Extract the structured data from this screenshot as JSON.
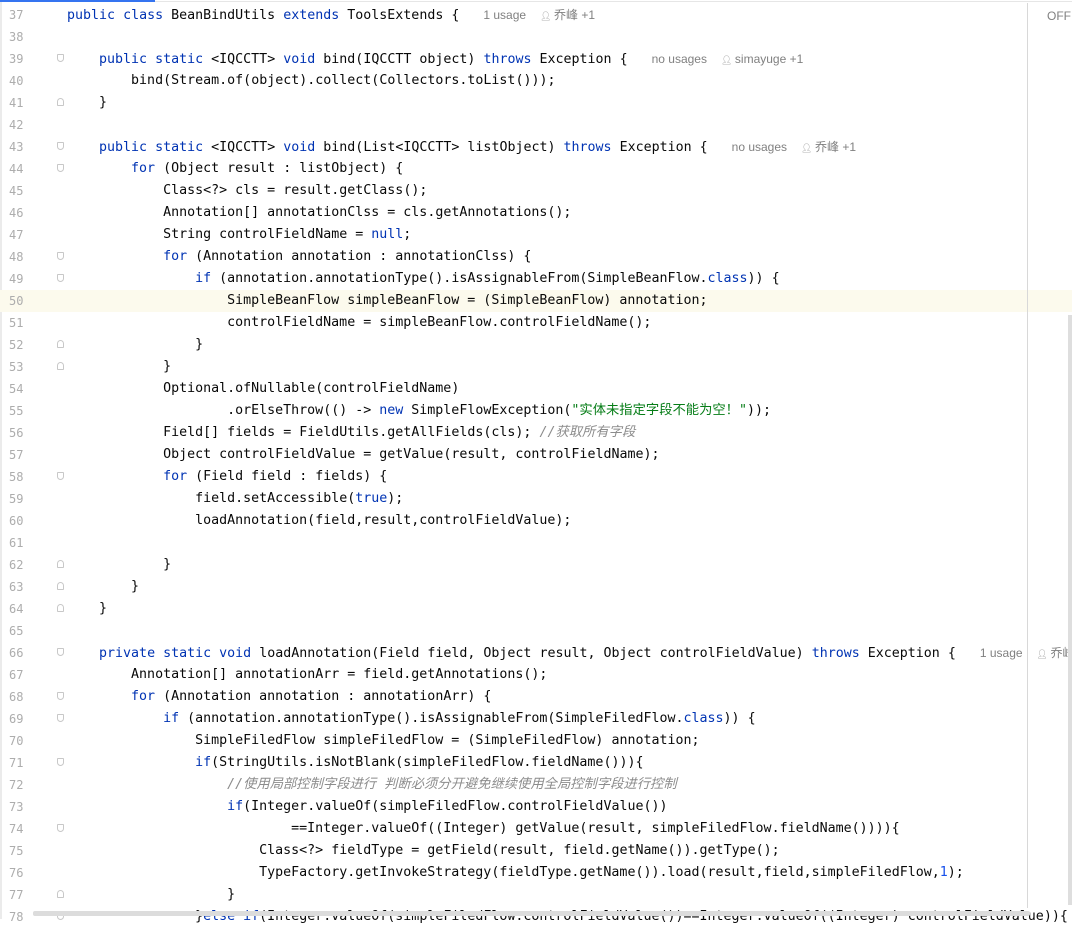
{
  "editor": {
    "inspection_toggle": "OFF",
    "current_line": 50,
    "colors": {
      "keyword": "#0033b3",
      "string": "#067d17",
      "comment": "#8c8c8c",
      "number": "#1750eb",
      "current_line_bg": "#fcfaed",
      "line_number": "#adadad"
    },
    "keywords": [
      "public",
      "class",
      "extends",
      "static",
      "void",
      "throws",
      "for",
      "if",
      "else",
      "new",
      "null",
      "true",
      "private"
    ],
    "lines": [
      {
        "n": "37",
        "code": "public class BeanBindUtils extends ToolsExtends { ",
        "usages": "1 usage",
        "author": "乔峰 +1"
      },
      {
        "n": "38",
        "code": ""
      },
      {
        "n": "39",
        "code": "    public static <IQCCTT> void bind(IQCCTT object) throws Exception { ",
        "usages": "no usages",
        "author": "simayuge +1",
        "fold": "open"
      },
      {
        "n": "40",
        "code": "        bind(Stream.of(object).collect(Collectors.toList()));"
      },
      {
        "n": "41",
        "code": "    }",
        "fold": "close"
      },
      {
        "n": "42",
        "code": ""
      },
      {
        "n": "43",
        "code": "    public static <IQCCTT> void bind(List<IQCCTT> listObject) throws Exception { ",
        "usages": "no usages",
        "author": "乔峰 +1",
        "fold": "open"
      },
      {
        "n": "44",
        "code": "        for (Object result : listObject) {",
        "fold": "open"
      },
      {
        "n": "45",
        "code": "            Class<?> cls = result.getClass();"
      },
      {
        "n": "46",
        "code": "            Annotation[] annotationClss = cls.getAnnotations();"
      },
      {
        "n": "47",
        "code": "            String controlFieldName = null;"
      },
      {
        "n": "48",
        "code": "            for (Annotation annotation : annotationClss) {",
        "fold": "open"
      },
      {
        "n": "49",
        "code": "                if (annotation.annotationType().isAssignableFrom(SimpleBeanFlow.class)) {",
        "fold": "open"
      },
      {
        "n": "50",
        "code": "                    SimpleBeanFlow simpleBeanFlow = (SimpleBeanFlow) annotation;"
      },
      {
        "n": "51",
        "code": "                    controlFieldName = simpleBeanFlow.controlFieldName();"
      },
      {
        "n": "52",
        "code": "                }",
        "fold": "close"
      },
      {
        "n": "53",
        "code": "            }",
        "fold": "close"
      },
      {
        "n": "54",
        "code": "            Optional.ofNullable(controlFieldName)"
      },
      {
        "n": "55",
        "code": "                    .orElseThrow(() -> new SimpleFlowException(\"实体未指定字段不能为空！\"));"
      },
      {
        "n": "56",
        "code": "            Field[] fields = FieldUtils.getAllFields(cls); //获取所有字段"
      },
      {
        "n": "57",
        "code": "            Object controlFieldValue = getValue(result, controlFieldName);"
      },
      {
        "n": "58",
        "code": "            for (Field field : fields) {",
        "fold": "open"
      },
      {
        "n": "59",
        "code": "                field.setAccessible(true);"
      },
      {
        "n": "60",
        "code": "                loadAnnotation(field,result,controlFieldValue);"
      },
      {
        "n": "61",
        "code": ""
      },
      {
        "n": "62",
        "code": "            }",
        "fold": "close"
      },
      {
        "n": "63",
        "code": "        }",
        "fold": "close"
      },
      {
        "n": "64",
        "code": "    }",
        "fold": "close"
      },
      {
        "n": "65",
        "code": ""
      },
      {
        "n": "66",
        "code": "    private static void loadAnnotation(Field field, Object result, Object controlFieldValue) throws Exception { ",
        "usages": "1 usage",
        "author": "乔峰",
        "fold": "open"
      },
      {
        "n": "67",
        "code": "        Annotation[] annotationArr = field.getAnnotations();"
      },
      {
        "n": "68",
        "code": "        for (Annotation annotation : annotationArr) {",
        "fold": "open"
      },
      {
        "n": "69",
        "code": "            if (annotation.annotationType().isAssignableFrom(SimpleFiledFlow.class)) {",
        "fold": "open"
      },
      {
        "n": "70",
        "code": "                SimpleFiledFlow simpleFiledFlow = (SimpleFiledFlow) annotation;"
      },
      {
        "n": "71",
        "code": "                if(StringUtils.isNotBlank(simpleFiledFlow.fieldName())){",
        "fold": "open"
      },
      {
        "n": "72",
        "code": "                    //使用局部控制字段进行 判断必须分开避免继续使用全局控制字段进行控制"
      },
      {
        "n": "73",
        "code": "                    if(Integer.valueOf(simpleFiledFlow.controlFieldValue())"
      },
      {
        "n": "74",
        "code": "                            ==Integer.valueOf((Integer) getValue(result, simpleFiledFlow.fieldName()))){",
        "fold": "open"
      },
      {
        "n": "75",
        "code": "                        Class<?> fieldType = getField(result, field.getName()).getType();"
      },
      {
        "n": "76",
        "code": "                        TypeFactory.getInvokeStrategy(fieldType.getName()).load(result,field,simpleFiledFlow,1);"
      },
      {
        "n": "77",
        "code": "                    }",
        "fold": "close"
      },
      {
        "n": "78",
        "code": "                }else if(Integer.valueOf(simpleFiledFlow.controlFieldValue())==Integer.valueOf((Integer) controlFieldValue)){",
        "fold": "open"
      }
    ]
  }
}
